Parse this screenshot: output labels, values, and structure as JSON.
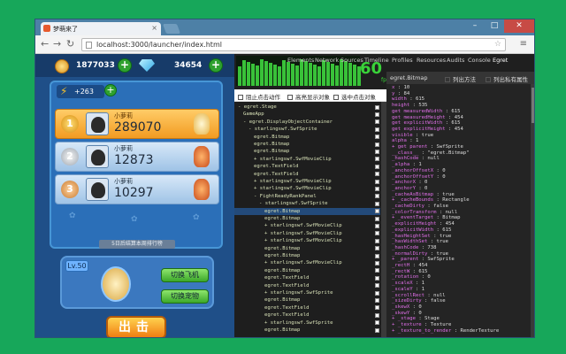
{
  "browser": {
    "tab_title": "梦萌来了",
    "url": "localhost:3000/launcher/index.html",
    "window_buttons": [
      "–",
      "□",
      "✕"
    ]
  },
  "game": {
    "coins": "1877033",
    "gems": "34654",
    "energy": "+263",
    "rank_rows": [
      {
        "rank": "1",
        "name": "小萝莉",
        "score": "289070"
      },
      {
        "rank": "2",
        "name": "小萝莉",
        "score": "12873"
      },
      {
        "rank": "3",
        "name": "小萝莉",
        "score": "10297"
      }
    ],
    "rank_button": "5日后结算本周排行榜",
    "level": "Lv.50",
    "switch_plane": "切换飞机",
    "switch_pet": "切换宠物",
    "start_button": "出击"
  },
  "devtools": {
    "fps": "60",
    "fps_label": "fps",
    "tabs": [
      "Elements",
      "Network",
      "Sources",
      "Timeline",
      "Profiles",
      "Resources",
      "Audits",
      "Console",
      "Egret"
    ],
    "options": [
      "阻止点击动作",
      "高亮显示对象",
      "选中点击对象"
    ],
    "tree_lines": [
      {
        "text": "- egret.Stage",
        "indent": 0,
        "cb": true
      },
      {
        "text": "GameApp",
        "indent": 1,
        "cb": true
      },
      {
        "text": "- egret.DisplayObjectContainer",
        "indent": 1,
        "cb": true
      },
      {
        "text": "- starlingswf.SwfSprite",
        "indent": 2,
        "cb": true
      },
      {
        "text": "egret.Bitmap",
        "indent": 3,
        "cb": true
      },
      {
        "text": "egret.Bitmap",
        "indent": 3,
        "cb": true
      },
      {
        "text": "egret.Bitmap",
        "indent": 3,
        "cb": true
      },
      {
        "text": "+ starlingswf.SwfMovieClip",
        "indent": 3,
        "cb": true
      },
      {
        "text": "egret.TextField",
        "indent": 3,
        "cb": true
      },
      {
        "text": "egret.TextField",
        "indent": 3,
        "cb": true
      },
      {
        "text": "+ starlingswf.SwfMovieClip",
        "indent": 3,
        "cb": true
      },
      {
        "text": "+ starlingswf.SwfMovieClip",
        "indent": 3,
        "cb": true
      },
      {
        "text": "- FightReadyRankPanel",
        "indent": 3,
        "cb": true
      },
      {
        "text": "- starlingswf.SwfSprite",
        "indent": 4,
        "cb": true
      },
      {
        "text": "egret.Bitmap",
        "indent": 5,
        "cb": true,
        "sel": true
      },
      {
        "text": "egret.Bitmap",
        "indent": 5,
        "cb": true
      },
      {
        "text": "+ starlingswf.SwfMovieClip",
        "indent": 5,
        "cb": true
      },
      {
        "text": "+ starlingswf.SwfMovieClip",
        "indent": 5,
        "cb": true
      },
      {
        "text": "+ starlingswf.SwfMovieClip",
        "indent": 5,
        "cb": true
      },
      {
        "text": "egret.Bitmap",
        "indent": 5,
        "cb": true
      },
      {
        "text": "egret.Bitmap",
        "indent": 5,
        "cb": true
      },
      {
        "text": "+ starlingswf.SwfMovieClip",
        "indent": 5,
        "cb": true
      },
      {
        "text": "egret.Bitmap",
        "indent": 5,
        "cb": true
      },
      {
        "text": "egret.TextField",
        "indent": 5,
        "cb": true
      },
      {
        "text": "egret.TextField",
        "indent": 5,
        "cb": true
      },
      {
        "text": "+ starlingswf.SwfSprite",
        "indent": 5,
        "cb": true
      },
      {
        "text": "egret.Bitmap",
        "indent": 5,
        "cb": true
      },
      {
        "text": "egret.TextField",
        "indent": 5,
        "cb": true
      },
      {
        "text": "egret.TextField",
        "indent": 5,
        "cb": true
      },
      {
        "text": "+ starlingswf.SwfSprite",
        "indent": 5,
        "cb": true
      },
      {
        "text": "egret.Bitmap",
        "indent": 5,
        "cb": true
      }
    ],
    "props_header": [
      "egret.Bitmap",
      "列出方法",
      "列出私有属性"
    ],
    "props": [
      {
        "k": "x",
        "v": " : 10"
      },
      {
        "k": "y",
        "v": " : 84"
      },
      {
        "k": "width",
        "v": " : 615"
      },
      {
        "k": "height",
        "v": " : 535"
      },
      {
        "k": "get measuredWidth",
        "v": " : 615"
      },
      {
        "k": "get measuredHeight",
        "v": " : 454"
      },
      {
        "k": "get explicitWidth",
        "v": " : 615"
      },
      {
        "k": "get explicitHeight",
        "v": " : 454"
      },
      {
        "k": "visible",
        "v": " : true"
      },
      {
        "k": "alpha",
        "v": " : 1"
      },
      {
        "k": "+ get parent",
        "v": " : SwfSprite"
      },
      {
        "k": "__class__",
        "v": " : \"egret.Bitmap\""
      },
      {
        "k": "_hashCode",
        "v": " : null"
      },
      {
        "k": "_alpha",
        "v": " : 1"
      },
      {
        "k": "_anchorOffsetX",
        "v": " : 0"
      },
      {
        "k": "_anchorOffsetY",
        "v": " : 0"
      },
      {
        "k": "_anchorX",
        "v": " : 0"
      },
      {
        "k": "_anchorY",
        "v": " : 0"
      },
      {
        "k": "_cacheAsBitmap",
        "v": " : true"
      },
      {
        "k": "+ _cacheBounds",
        "v": " : Rectangle"
      },
      {
        "k": "_cacheDirty",
        "v": " : false"
      },
      {
        "k": "_colorTransform",
        "v": " : null"
      },
      {
        "k": "+ _eventTarget",
        "v": " : Bitmap"
      },
      {
        "k": "_explicitHeight",
        "v": " : 454"
      },
      {
        "k": "_explicitWidth",
        "v": " : 615"
      },
      {
        "k": "_hasHeightSet",
        "v": " : true"
      },
      {
        "k": "_hasWidthSet",
        "v": " : true"
      },
      {
        "k": "_hashCode",
        "v": " : 738"
      },
      {
        "k": "_normalDirty",
        "v": " : true"
      },
      {
        "k": "+ _parent",
        "v": " : SwfSprite"
      },
      {
        "k": "_rectH",
        "v": " : 454"
      },
      {
        "k": "_rectW",
        "v": " : 615"
      },
      {
        "k": "_rotation",
        "v": " : 0"
      },
      {
        "k": "_scaleX",
        "v": " : 1"
      },
      {
        "k": "_scaleY",
        "v": " : 1"
      },
      {
        "k": "_scrollRect",
        "v": " : null"
      },
      {
        "k": "_sizeDirty",
        "v": " : false"
      },
      {
        "k": "_skewX",
        "v": " : 0"
      },
      {
        "k": "_skewY",
        "v": " : 0"
      },
      {
        "k": "+ _stage",
        "v": " : Stage"
      },
      {
        "k": "+ _texture",
        "v": " : Texture"
      },
      {
        "k": "+ _texture_to_render",
        "v": " : RenderTexture"
      }
    ]
  },
  "colors": {
    "desktop": "#17a75a",
    "gold_row": "#f29b22",
    "fps_green": "#39d239",
    "prop_key": "#e06fe8"
  }
}
